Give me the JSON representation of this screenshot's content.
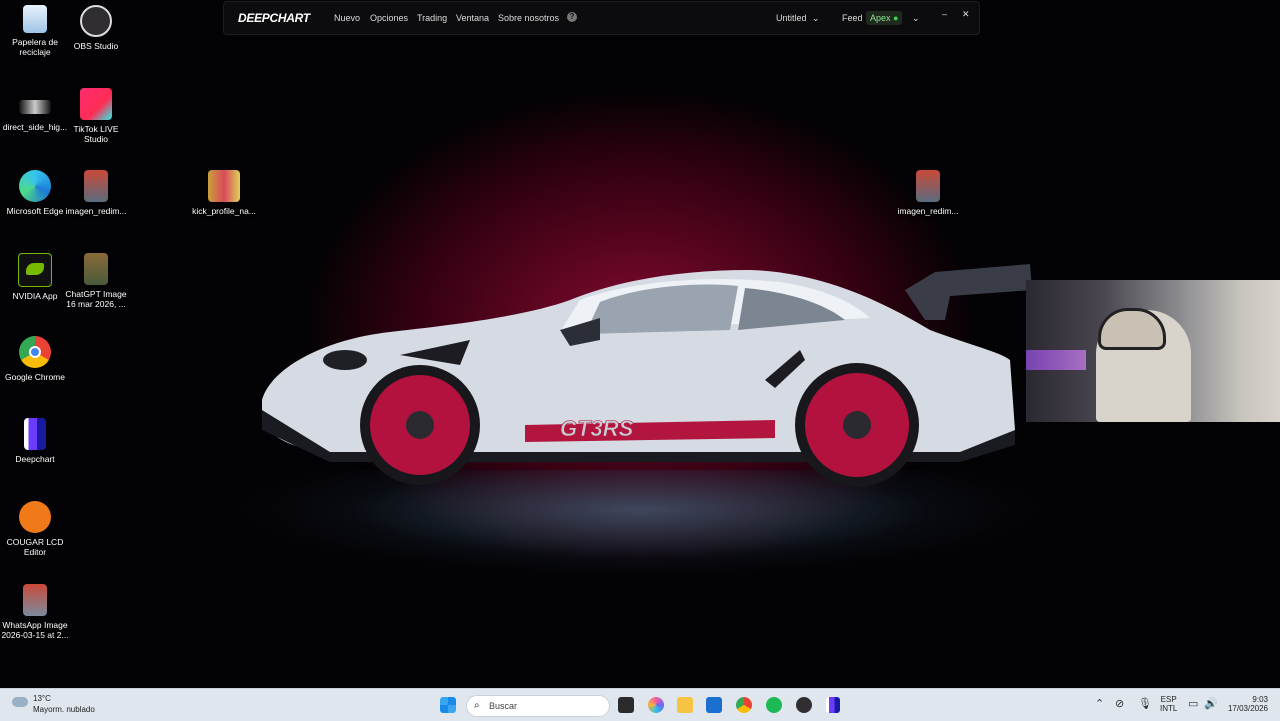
{
  "desktop_icons": [
    {
      "label": "Papelera de reciclaje",
      "icon": "recycle-bin-icon"
    },
    {
      "label": "OBS Studio",
      "icon": "obs-icon"
    },
    {
      "label": "direct_side_hig...",
      "icon": "video-file-icon"
    },
    {
      "label": "TikTok LIVE Studio",
      "icon": "tiktok-icon"
    },
    {
      "label": "Microsoft Edge",
      "icon": "edge-icon"
    },
    {
      "label": "imagen_redim...",
      "icon": "image-file-icon"
    },
    {
      "label": "kick_profile_na...",
      "icon": "image-file-icon"
    },
    {
      "label": "imagen_redim...",
      "icon": "image-file-icon"
    },
    {
      "label": "NVIDIA App",
      "icon": "nvidia-icon"
    },
    {
      "label": "ChatGPT Image 16 mar 2026, ...",
      "icon": "image-file-icon"
    },
    {
      "label": "Google Chrome",
      "icon": "chrome-icon"
    },
    {
      "label": "Deepchart",
      "icon": "deepchart-icon"
    },
    {
      "label": "COUGAR LCD Editor",
      "icon": "cougar-icon"
    },
    {
      "label": "WhatsApp Image 2026-03-15 at 2...",
      "icon": "image-file-icon"
    }
  ],
  "app": {
    "logo": "DEEPCHART",
    "menu": [
      "Nuevo",
      "Opciones",
      "Trading",
      "Ventana",
      "Sobre nosotros"
    ],
    "help": "?",
    "workspace": "Untitled",
    "feed_label": "Feed",
    "feed_value": "Apex",
    "minimize": "–",
    "close": "✕"
  },
  "wallpaper": {
    "car_text": "GT3 RS"
  },
  "taskbar": {
    "weather_temp": "13°C",
    "weather_desc": "Mayorm. nublado",
    "search_placeholder": "Buscar",
    "lang_top": "ESP",
    "lang_bottom": "INTL",
    "time": "9:03",
    "date": "17/03/2026"
  }
}
